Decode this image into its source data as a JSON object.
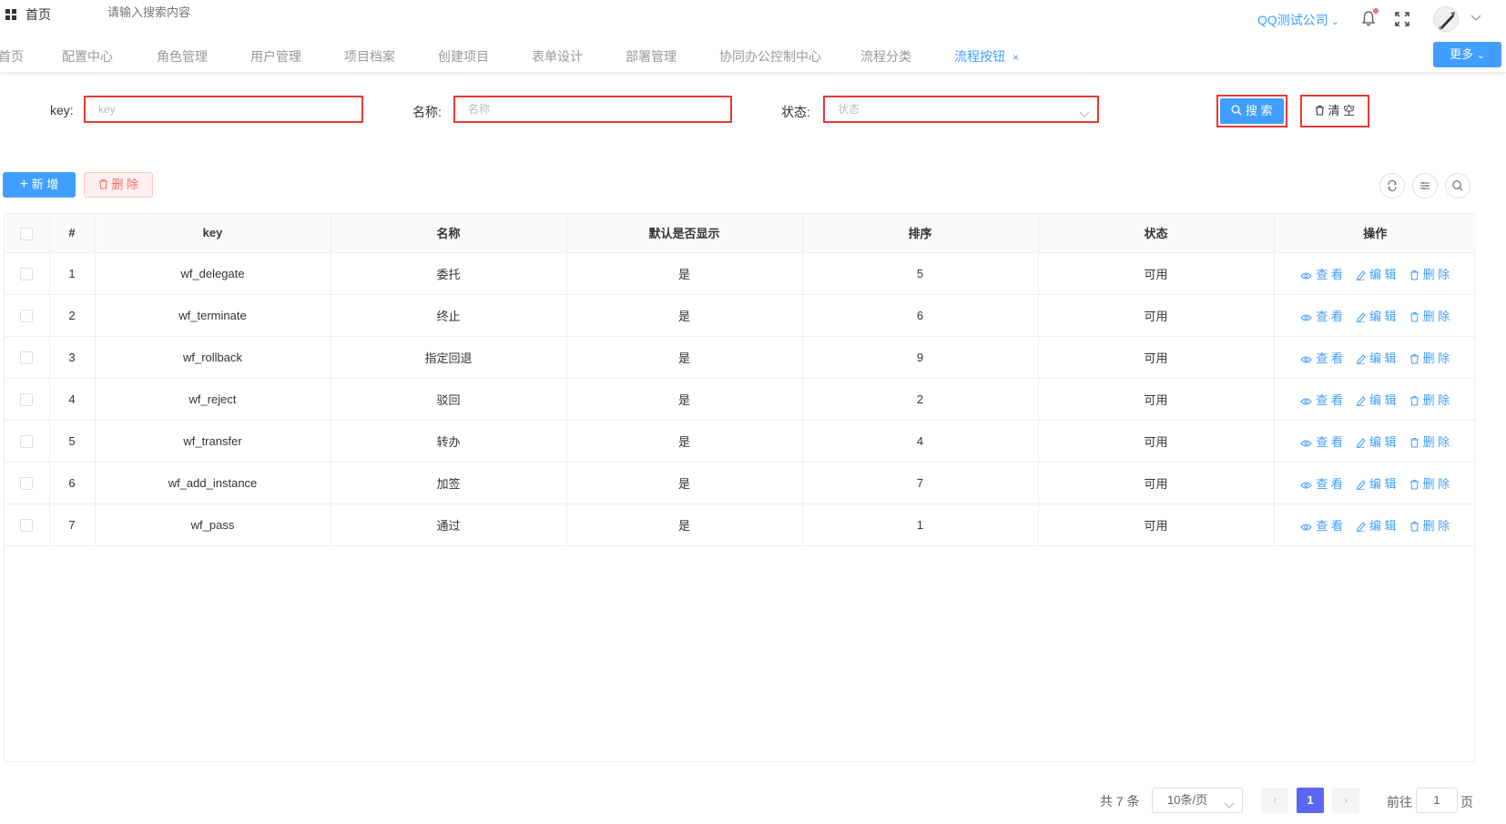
{
  "header": {
    "home_label": "首页",
    "search_placeholder": "请输入搜索内容",
    "company": "QQ测试公司",
    "icons": [
      "grid-icon",
      "bell-icon",
      "fullscreen-icon",
      "avatar",
      "chevron-down-icon"
    ]
  },
  "tabs": [
    {
      "label": "首页"
    },
    {
      "label": "配置中心"
    },
    {
      "label": "角色管理"
    },
    {
      "label": "用户管理"
    },
    {
      "label": "项目档案"
    },
    {
      "label": "创建项目"
    },
    {
      "label": "表单设计"
    },
    {
      "label": "部署管理"
    },
    {
      "label": "协同办公控制中心"
    },
    {
      "label": "流程分类"
    },
    {
      "label": "流程按钮",
      "active": true
    }
  ],
  "more_label": "更多",
  "filters": {
    "key_label": "key:",
    "key_placeholder": "key",
    "name_label": "名称:",
    "name_placeholder": "名称",
    "status_label": "状态:",
    "status_placeholder": "状态",
    "search_button": "搜 索",
    "clear_button": "清 空"
  },
  "toolbar": {
    "add_button": "新 增",
    "delete_button": "删 除"
  },
  "table": {
    "columns": [
      "#",
      "key",
      "名称",
      "默认是否显示",
      "排序",
      "状态",
      "操作"
    ],
    "rows": [
      {
        "index": "1",
        "key": "wf_delegate",
        "name": "委托",
        "default_show": "是",
        "sort": "5",
        "status": "可用"
      },
      {
        "index": "2",
        "key": "wf_terminate",
        "name": "终止",
        "default_show": "是",
        "sort": "6",
        "status": "可用"
      },
      {
        "index": "3",
        "key": "wf_rollback",
        "name": "指定回退",
        "default_show": "是",
        "sort": "9",
        "status": "可用"
      },
      {
        "index": "4",
        "key": "wf_reject",
        "name": "驳回",
        "default_show": "是",
        "sort": "2",
        "status": "可用"
      },
      {
        "index": "5",
        "key": "wf_transfer",
        "name": "转办",
        "default_show": "是",
        "sort": "4",
        "status": "可用"
      },
      {
        "index": "6",
        "key": "wf_add_instance",
        "name": "加签",
        "default_show": "是",
        "sort": "7",
        "status": "可用"
      },
      {
        "index": "7",
        "key": "wf_pass",
        "name": "通过",
        "default_show": "是",
        "sort": "1",
        "status": "可用"
      }
    ],
    "actions": {
      "view": "查 看",
      "edit": "编 辑",
      "delete": "删 除"
    }
  },
  "pagination": {
    "total_text": "共 7 条",
    "page_size": "10条/页",
    "current_page": "1",
    "goto_label": "前往",
    "goto_value": "1",
    "page_unit": "页"
  },
  "colors": {
    "primary": "#409eff",
    "danger": "#f56c6c",
    "highlight_border": "#e53935",
    "current_page": "#5b67f0"
  }
}
